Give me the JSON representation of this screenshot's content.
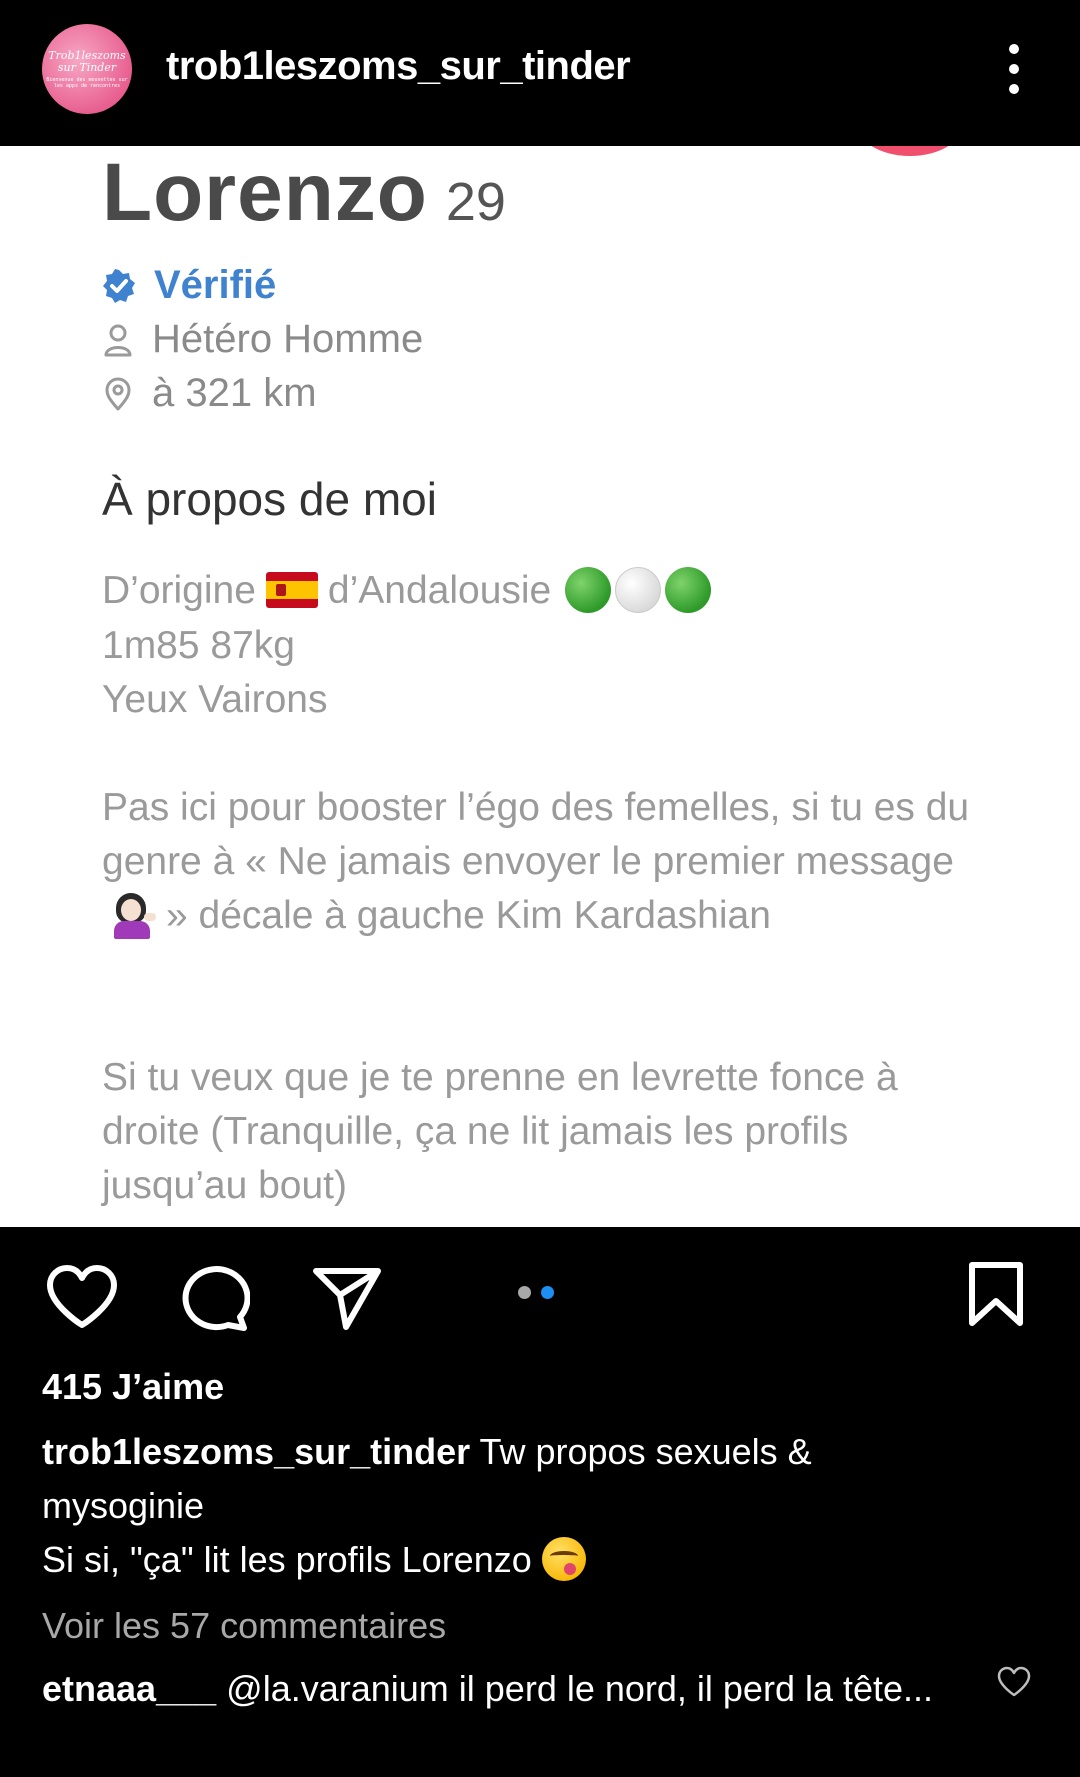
{
  "header": {
    "account_name": "trob1leszoms_sur_tinder",
    "avatar_text": "Trob1leszoms sur Tinder",
    "avatar_subtext": "Bienvenue des mouvettes sur les apps de rencontres"
  },
  "post": {
    "profile": {
      "name": "Lorenzo",
      "age": "29",
      "verified_label": "Vérifié",
      "orientation": "Hétéro Homme",
      "distance": "à 321 km",
      "about_title": "À propos de moi",
      "bio_line1_a": "D’origine",
      "bio_line1_b": "d’Andalousie",
      "bio_line2": "1m85 87kg",
      "bio_line3": "Yeux Vairons",
      "bio_para2_a": "Pas ici pour booster l’égo des femelles, si tu es du genre à « Ne jamais envoyer le premier message",
      "bio_para2_b": "» décale à gauche Kim Kardashian",
      "bio_para3": "Si tu veux que je te prenne en levrette fonce à droite (Tranquille, ça ne lit jamais les profils jusqu’au bout)"
    },
    "colors": {
      "verified": "#3f82cf",
      "carousel_active": "#1e8ff2",
      "carousel_inactive": "#a8a8a8"
    },
    "carousel": {
      "total": 2,
      "active_index": 2
    }
  },
  "actions": {
    "like_icon": "heart-icon",
    "comment_icon": "comment-icon",
    "share_icon": "send-icon",
    "save_icon": "bookmark-icon"
  },
  "meta": {
    "likes": "415 J’aime",
    "caption_user": "trob1leszoms_sur_tinder",
    "caption_text_line1": "Tw propos sexuels & mysoginie",
    "caption_text_line2": "Si si, \"ça\" lit les profils Lorenzo",
    "view_comments": "Voir les 57 commentaires",
    "comment_user": "etnaaa___",
    "comment_text": "@la.varanium il perd le nord, il perd la tête..."
  }
}
